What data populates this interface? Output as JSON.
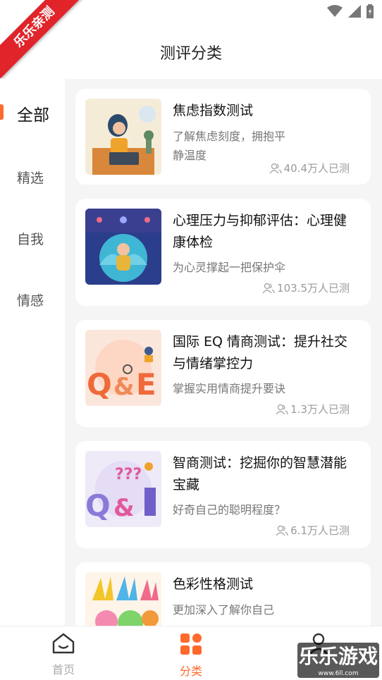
{
  "ribbon": "乐乐亲测",
  "page_title": "测评分类",
  "sidebar": {
    "items": [
      {
        "label": "全部"
      },
      {
        "label": "精选"
      },
      {
        "label": "自我"
      },
      {
        "label": "情感"
      }
    ]
  },
  "cards": [
    {
      "title": "焦虑指数测试",
      "desc": "了解焦虑刻度，拥抱平静温度",
      "count": "40.4万人已测"
    },
    {
      "title": "心理压力与抑郁评估：心理健康体检",
      "desc": "为心灵撑起一把保护伞",
      "count": "103.5万人已测"
    },
    {
      "title": "国际 EQ 情商测试：提升社交与情绪掌控力",
      "desc": "掌握实用情商提升要诀",
      "count": "1.3万人已测"
    },
    {
      "title": "智商测试：挖掘你的智慧潜能宝藏",
      "desc": "好奇自己的聪明程度？",
      "count": "6.1万人已测"
    },
    {
      "title": "色彩性格测试",
      "desc": "更加深入了解你自己",
      "count": ""
    }
  ],
  "tabs": [
    {
      "label": "首页"
    },
    {
      "label": "分类"
    }
  ],
  "watermark": "乐乐游戏",
  "watermark_small": "www.6ll.com",
  "colors": {
    "accent": "#ff6a2c",
    "ribbon": "#e0242a"
  }
}
